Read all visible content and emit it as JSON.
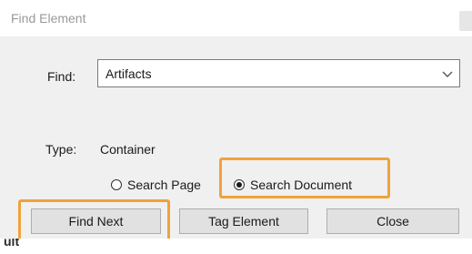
{
  "dialog": {
    "title": "Find Element",
    "find_label": "Find:",
    "find_value": "Artifacts",
    "type_label": "Type:",
    "type_value": "Container",
    "radios": [
      {
        "label": "Search Page",
        "checked": false
      },
      {
        "label": "Search Document",
        "checked": true
      }
    ],
    "buttons": {
      "find_next": "Find Next",
      "tag_element": "Tag Element",
      "close": "Close"
    }
  },
  "highlight_color": "#f0a23a",
  "caption_fragment": "ult"
}
